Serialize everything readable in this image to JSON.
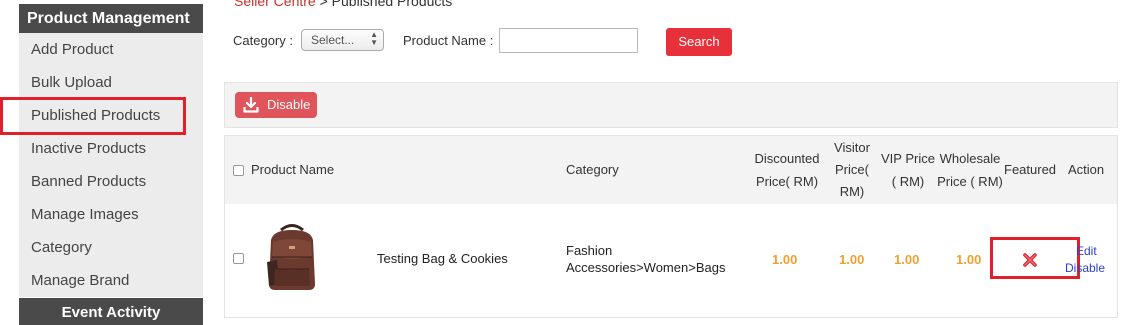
{
  "sidebar": {
    "header": "Product Management",
    "items": [
      {
        "label": "Add Product"
      },
      {
        "label": "Bulk Upload"
      },
      {
        "label": "Published Products"
      },
      {
        "label": "Inactive Products"
      },
      {
        "label": "Banned Products"
      },
      {
        "label": "Manage Images"
      },
      {
        "label": "Category"
      },
      {
        "label": "Manage Brand"
      }
    ],
    "footer": "Event Activity"
  },
  "breadcrumb": {
    "root": "Seller Centre",
    "separator": " > ",
    "current": "Published Products"
  },
  "filters": {
    "category_label": "Category :",
    "category_selected": "Select...",
    "product_name_label": "Product Name :",
    "product_name_value": "",
    "search_label": "Search"
  },
  "toolbar": {
    "disable_label": "Disable"
  },
  "table": {
    "headers": {
      "product_name": "Product Name",
      "category": "Category",
      "discounted_price": [
        "Discounted",
        "Price( RM)"
      ],
      "visitor_price": [
        "Visitor",
        "Price(",
        "RM)"
      ],
      "vip_price": [
        "VIP Price",
        "( RM)"
      ],
      "wholesale_price": [
        "Wholesale",
        "Price ( RM)"
      ],
      "featured": "Featured",
      "action": "Action"
    },
    "rows": [
      {
        "product_name": "Testing Bag & Cookies",
        "category_line1": "Fashion",
        "category_line2": "Accessories>Women>Bags",
        "discounted_price": "1.00",
        "visitor_price": "1.00",
        "vip_price": "1.00",
        "wholesale_price": "1.00",
        "featured_icon": "red-x-icon",
        "edit_label": "Edit",
        "disable_label": "Disable"
      }
    ]
  },
  "colors": {
    "accent_red": "#e8303a",
    "sidebar_dark": "#4a4a4a",
    "price_orange": "#f0a030",
    "link_blue": "#2a3fd6",
    "highlight_red": "#e0202b"
  }
}
